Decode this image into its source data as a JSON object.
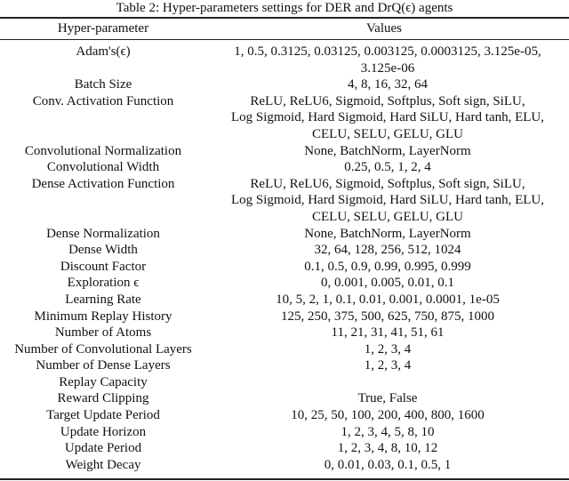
{
  "caption": "Table 2: Hyper-parameters settings for DER and DrQ(ϵ) agents",
  "table": {
    "headers": [
      "Hyper-parameter",
      "Values"
    ],
    "rows": [
      {
        "param": "Adam's(ϵ)",
        "value_lines": [
          "1, 0.5, 0.3125, 0.03125, 0.003125, 0.0003125, 3.125e-05,",
          "3.125e-06"
        ]
      },
      {
        "param": "Batch Size",
        "value_lines": [
          "4, 8, 16, 32, 64"
        ]
      },
      {
        "param": "Conv. Activation Function",
        "value_lines": [
          "ReLU, ReLU6, Sigmoid, Softplus, Soft sign, SiLU,",
          "Log Sigmoid, Hard Sigmoid, Hard SiLU, Hard tanh, ELU,",
          "CELU, SELU, GELU, GLU"
        ]
      },
      {
        "param": "Convolutional Normalization",
        "value_lines": [
          "None, BatchNorm, LayerNorm"
        ]
      },
      {
        "param": "Convolutional Width",
        "value_lines": [
          "0.25, 0.5, 1, 2, 4"
        ]
      },
      {
        "param": "Dense Activation Function",
        "value_lines": [
          "ReLU, ReLU6, Sigmoid, Softplus, Soft sign, SiLU,",
          "Log Sigmoid, Hard Sigmoid, Hard SiLU, Hard tanh, ELU,",
          "CELU, SELU, GELU, GLU"
        ]
      },
      {
        "param": "Dense Normalization",
        "value_lines": [
          "None, BatchNorm, LayerNorm"
        ]
      },
      {
        "param": "Dense Width",
        "value_lines": [
          "32, 64, 128, 256, 512, 1024"
        ]
      },
      {
        "param": "Discount Factor",
        "value_lines": [
          "0.1, 0.5, 0.9, 0.99, 0.995, 0.999"
        ]
      },
      {
        "param": "Exploration ϵ",
        "value_lines": [
          "0, 0.001, 0.005, 0.01, 0.1"
        ]
      },
      {
        "param": "Learning Rate",
        "value_lines": [
          "10, 5, 2, 1, 0.1, 0.01, 0.001, 0.0001, 1e-05"
        ]
      },
      {
        "param": "Minimum Replay History",
        "value_lines": [
          "125, 250, 375, 500, 625, 750, 875, 1000"
        ]
      },
      {
        "param": "Number of Atoms",
        "value_lines": [
          "11, 21, 31, 41, 51, 61"
        ]
      },
      {
        "param": "Number of Convolutional Layers",
        "value_lines": [
          "1, 2, 3, 4"
        ]
      },
      {
        "param": "Number of Dense Layers",
        "value_lines": [
          "1, 2, 3, 4"
        ]
      },
      {
        "param": "Replay Capacity",
        "value_lines": [
          ""
        ]
      },
      {
        "param": "Reward Clipping",
        "value_lines": [
          "True, False"
        ]
      },
      {
        "param": "Target Update Period",
        "value_lines": [
          "10, 25, 50, 100, 200, 400, 800, 1600"
        ]
      },
      {
        "param": "Update Horizon",
        "value_lines": [
          "1, 2, 3, 4, 5, 8, 10"
        ]
      },
      {
        "param": "Update Period",
        "value_lines": [
          "1, 2, 3, 4, 8, 10, 12"
        ]
      },
      {
        "param": "Weight Decay",
        "value_lines": [
          "0, 0.01, 0.03, 0.1, 0.5, 1"
        ]
      }
    ]
  }
}
